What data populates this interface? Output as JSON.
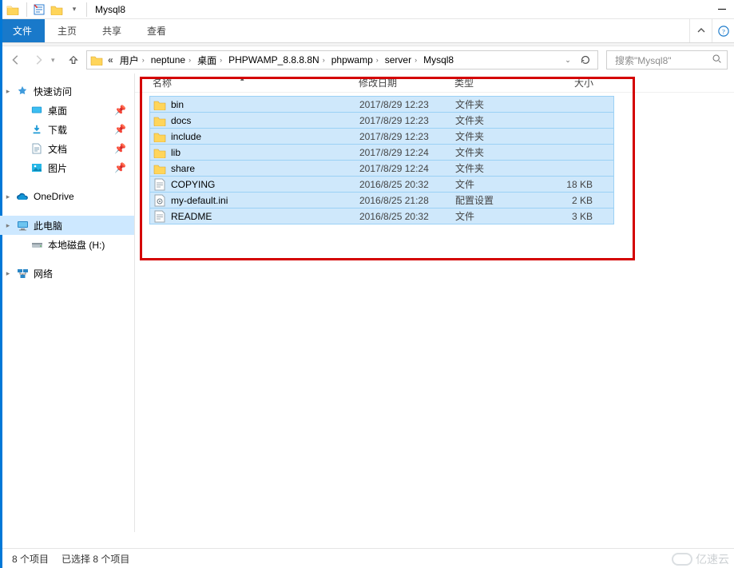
{
  "title": "Mysql8",
  "ribbon": {
    "file": "文件",
    "home": "主页",
    "share": "共享",
    "view": "查看"
  },
  "breadcrumb": [
    "用户",
    "neptune",
    "桌面",
    "PHPWAMP_8.8.8.8N",
    "phpwamp",
    "server",
    "Mysql8"
  ],
  "search_placeholder": "搜索\"Mysql8\"",
  "sidebar": {
    "quick_access": "快速访问",
    "desktop": "桌面",
    "downloads": "下载",
    "documents": "文档",
    "pictures": "图片",
    "onedrive": "OneDrive",
    "this_pc": "此电脑",
    "local_disk": "本地磁盘 (H:)",
    "network": "网络"
  },
  "columns": {
    "name": "名称",
    "date": "修改日期",
    "type": "类型",
    "size": "大小"
  },
  "files": [
    {
      "icon": "folder",
      "name": "bin",
      "date": "2017/8/29 12:23",
      "type": "文件夹",
      "size": ""
    },
    {
      "icon": "folder",
      "name": "docs",
      "date": "2017/8/29 12:23",
      "type": "文件夹",
      "size": ""
    },
    {
      "icon": "folder",
      "name": "include",
      "date": "2017/8/29 12:23",
      "type": "文件夹",
      "size": ""
    },
    {
      "icon": "folder",
      "name": "lib",
      "date": "2017/8/29 12:24",
      "type": "文件夹",
      "size": ""
    },
    {
      "icon": "folder",
      "name": "share",
      "date": "2017/8/29 12:24",
      "type": "文件夹",
      "size": ""
    },
    {
      "icon": "text",
      "name": "COPYING",
      "date": "2016/8/25 20:32",
      "type": "文件",
      "size": "18 KB"
    },
    {
      "icon": "ini",
      "name": "my-default.ini",
      "date": "2016/8/25 21:28",
      "type": "配置设置",
      "size": "2 KB"
    },
    {
      "icon": "text",
      "name": "README",
      "date": "2016/8/25 20:32",
      "type": "文件",
      "size": "3 KB"
    }
  ],
  "status": {
    "count": "8 个项目",
    "selected": "已选择 8 个项目"
  },
  "watermark": "亿速云"
}
